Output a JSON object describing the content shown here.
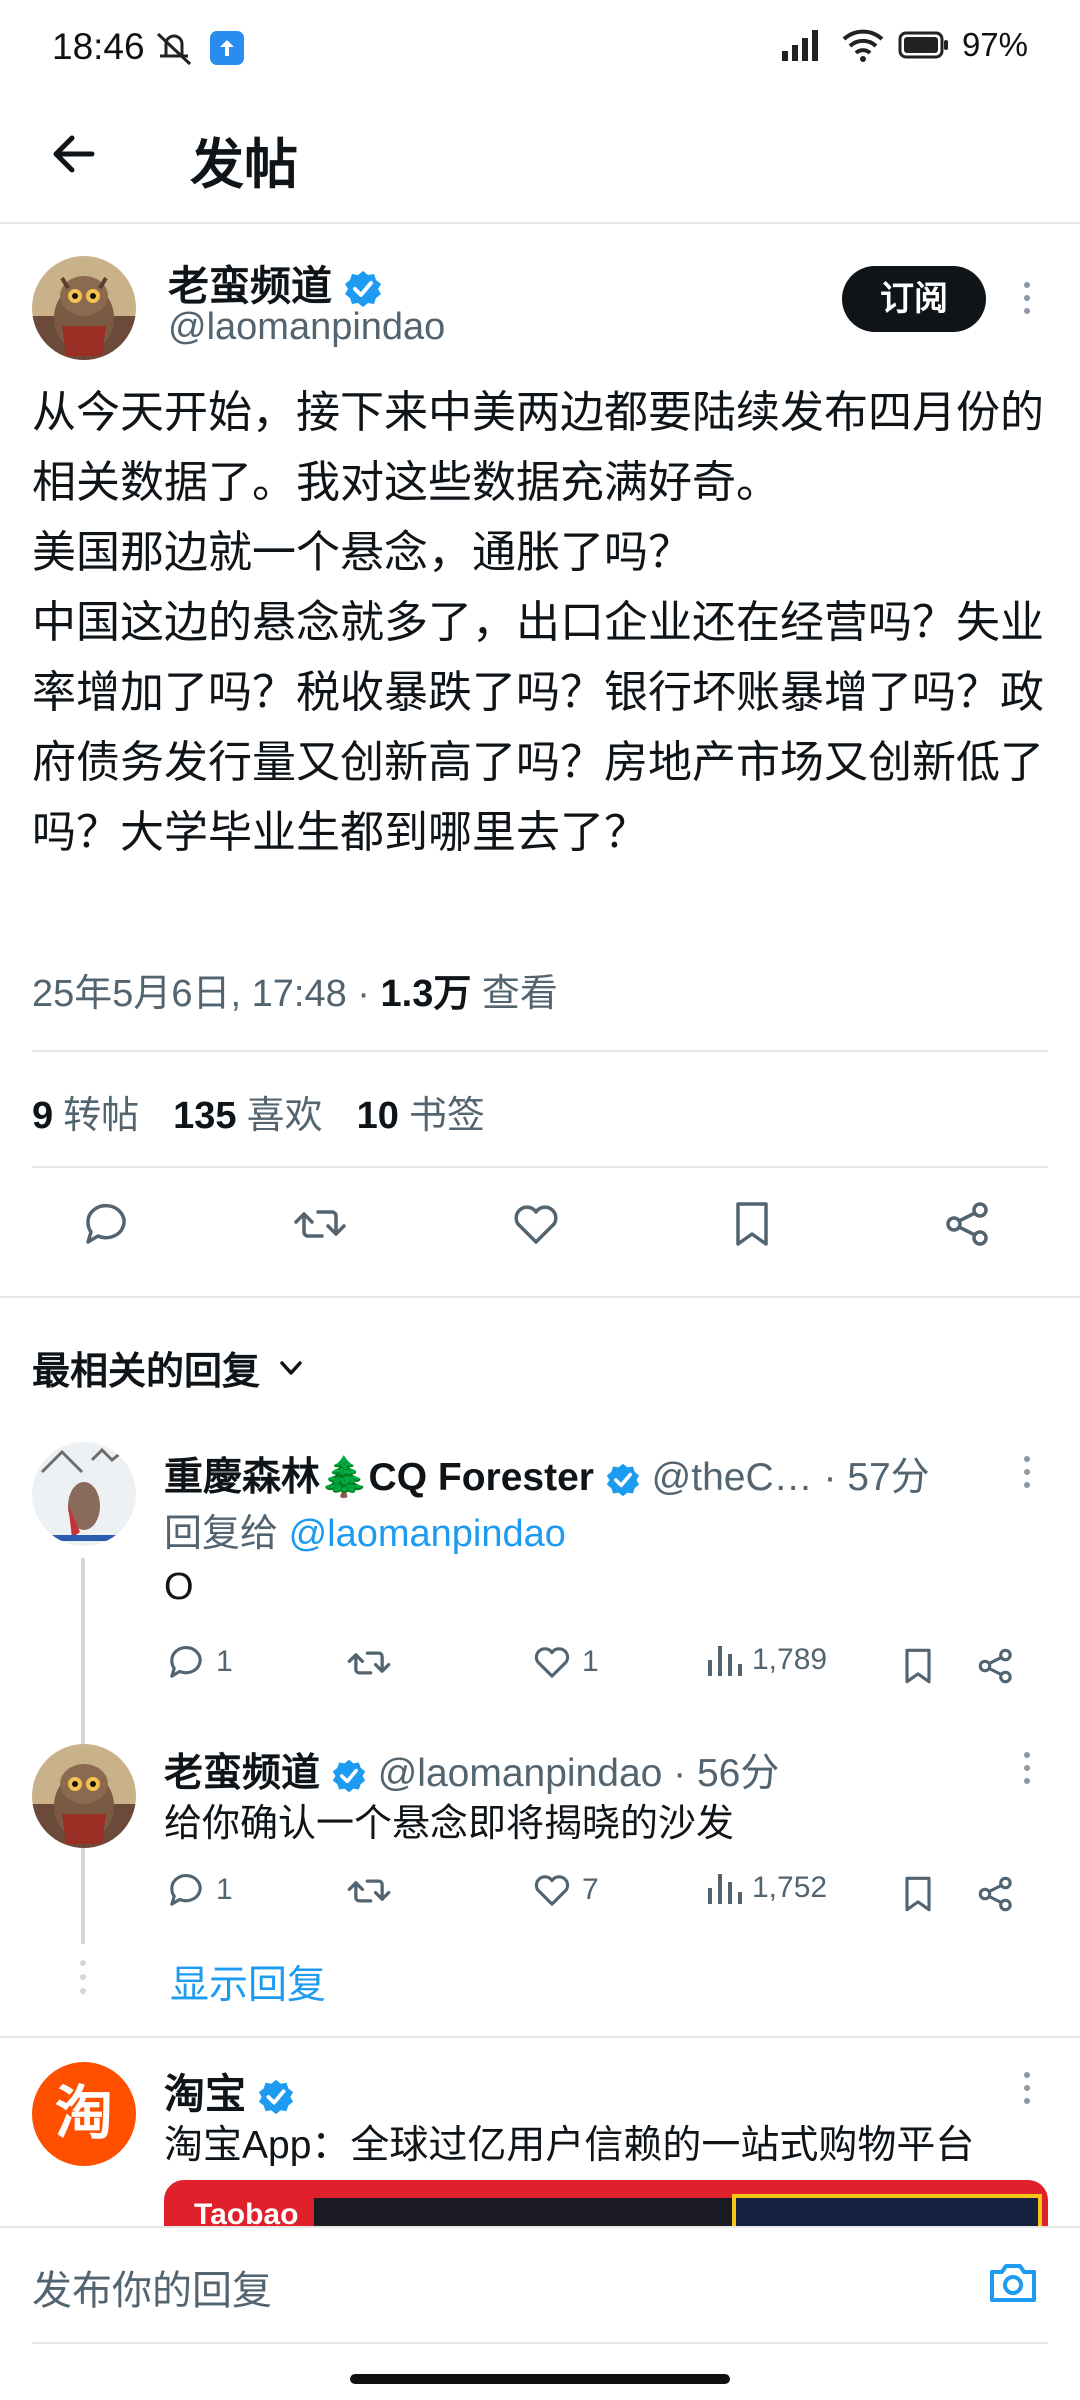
{
  "status_bar": {
    "time": "18:46",
    "battery": "97%",
    "icons": [
      "mute-icon",
      "upload-icon",
      "signal-icon",
      "wifi-icon",
      "battery-icon"
    ]
  },
  "header": {
    "title": "发帖",
    "back_icon": "back-arrow-icon"
  },
  "post": {
    "author_name": "老蛮频道",
    "author_handle": "@laomanpindao",
    "subscribe_label": "订阅",
    "body": "从今天开始，接下来中美两边都要陆续发布四月份的相关数据了。我对这些数据充满好奇。\n美国那边就一个悬念，通胀了吗？\n中国这边的悬念就多了，出口企业还在经营吗？失业率增加了吗？税收暴跌了吗？银行坏账暴增了吗？政府债务发行量又创新高了吗？房地产市场又创新低了吗？大学毕业生都到哪里去了？",
    "date": "25年5月6日, 17:48 · ",
    "views_count": "1.3万",
    "views_label": " 查看",
    "stats": {
      "reposts_count": "9",
      "reposts_label": "转帖",
      "likes_count": "135",
      "likes_label": "喜欢",
      "bookmarks_count": "10",
      "bookmarks_label": "书签"
    }
  },
  "replies_section": {
    "sort_label": "最相关的回复"
  },
  "replies": [
    {
      "name": "重慶森林🌲CQ Forester",
      "handle": "@theC…",
      "time": " · 57分",
      "reply_to_label": "回复给 ",
      "reply_to_handle": "@laomanpindao",
      "text": "O",
      "comments": "1",
      "likes": "1",
      "views": "1,789"
    },
    {
      "name": "老蛮频道",
      "handle": "@laomanpindao",
      "time": " · 56分",
      "text": "给你确认一个悬念即将揭晓的沙发",
      "comments": "1",
      "likes": "7",
      "views": "1,752"
    }
  ],
  "show_replies_label": "显示回复",
  "ad": {
    "avatar_char": "淘",
    "name": "淘宝",
    "text": "淘宝App：全球过亿用户信赖的一站式购物平台",
    "media_label": "Taobao"
  },
  "composer": {
    "placeholder": "发布你的回复"
  },
  "colors": {
    "accent": "#1d9bf0",
    "text": "#0f1419",
    "muted": "#536471",
    "brand_ad": "#ff5000"
  }
}
